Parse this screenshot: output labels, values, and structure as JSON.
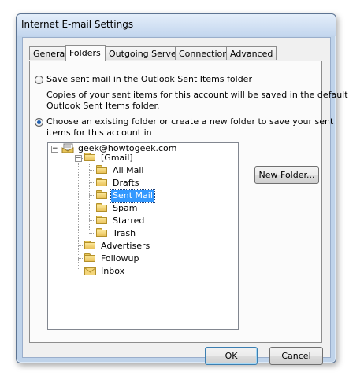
{
  "window": {
    "title": "Internet E-mail Settings"
  },
  "tabs": [
    {
      "label": "General",
      "active": false
    },
    {
      "label": "Folders",
      "active": true
    },
    {
      "label": "Outgoing Server",
      "active": false
    },
    {
      "label": "Connection",
      "active": false
    },
    {
      "label": "Advanced",
      "active": false
    }
  ],
  "options": {
    "save_sent_label": "Save sent mail in the Outlook Sent Items folder",
    "save_sent_selected": false,
    "save_sent_desc_line1": "Copies of your sent items for this account will be saved in the default",
    "save_sent_desc_line2": "Outlook Sent Items folder.",
    "choose_existing_label_line1": "Choose an existing folder or create a new folder to save your sent",
    "choose_existing_label_line2": "items for this account in",
    "choose_existing_selected": true
  },
  "tree": {
    "account": "geek@howtogeek.com",
    "gmail": "[Gmail]",
    "gmail_children": [
      "All Mail",
      "Drafts",
      "Sent Mail",
      "Spam",
      "Starred",
      "Trash"
    ],
    "selected": "Sent Mail",
    "others": [
      "Advertisers",
      "Followup",
      "Inbox"
    ]
  },
  "buttons": {
    "new_folder": "New Folder...",
    "ok": "OK",
    "cancel": "Cancel"
  }
}
